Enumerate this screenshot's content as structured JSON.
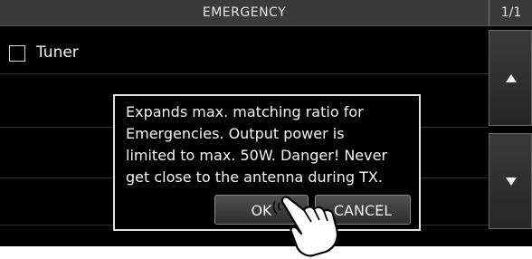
{
  "header": {
    "title": "EMERGENCY",
    "page_indicator": "1/1"
  },
  "list": {
    "items": [
      {
        "label": "Tuner",
        "checked": false
      }
    ]
  },
  "scroll": {
    "up_icon": "triangle-up",
    "down_icon": "triangle-down"
  },
  "dialog": {
    "message_lines": [
      "Expands max. matching ratio for",
      "Emergencies. Output power is",
      "limited to max. 50W. Danger! Never",
      "get close to the antenna during TX."
    ],
    "ok_label": "OK",
    "cancel_label": "CANCEL"
  },
  "pointer": {
    "icon": "pointing-hand-icon"
  }
}
